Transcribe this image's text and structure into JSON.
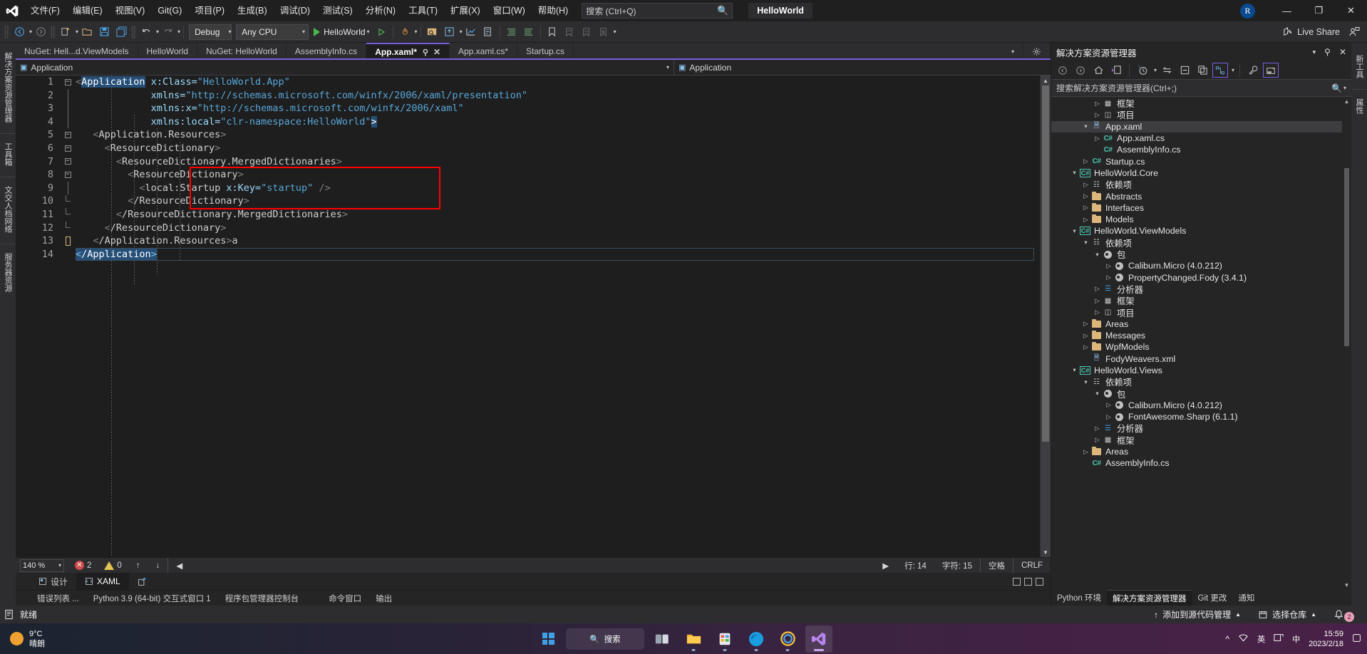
{
  "titlebar": {
    "menu": [
      "文件(F)",
      "编辑(E)",
      "视图(V)",
      "Git(G)",
      "项目(P)",
      "生成(B)",
      "调试(D)",
      "测试(S)",
      "分析(N)",
      "工具(T)",
      "扩展(X)",
      "窗口(W)",
      "帮助(H)"
    ],
    "search_placeholder": "搜索 (Ctrl+Q)",
    "project_title": "HelloWorld",
    "account_initial": "R",
    "minimize": "—",
    "restore": "❐",
    "close": "✕"
  },
  "toolbar": {
    "config": "Debug",
    "platform": "Any CPU",
    "run_target": "HelloWorld",
    "live_share": "Live Share"
  },
  "tabs": [
    {
      "label": "NuGet: Hell...d.ViewModels",
      "active": false
    },
    {
      "label": "HelloWorld",
      "active": false
    },
    {
      "label": "NuGet: HelloWorld",
      "active": false
    },
    {
      "label": "AssemblyInfo.cs",
      "active": false
    },
    {
      "label": "App.xaml*",
      "active": true
    },
    {
      "label": "App.xaml.cs*",
      "active": false
    },
    {
      "label": "Startup.cs",
      "active": false
    }
  ],
  "navbar": {
    "left_scope": "Application",
    "right_scope": "Application"
  },
  "left_dock": [
    "解决方案资源管理器",
    "工具箱",
    "文交人档网络",
    "服务器资源"
  ],
  "right_dock": [
    "新工具",
    "属性"
  ],
  "editor": {
    "lines": [
      {
        "n": 1,
        "fold": "minus"
      },
      {
        "n": 2,
        "fold": ""
      },
      {
        "n": 3,
        "fold": ""
      },
      {
        "n": 4,
        "fold": ""
      },
      {
        "n": 5,
        "fold": "minus"
      },
      {
        "n": 6,
        "fold": "minus"
      },
      {
        "n": 7,
        "fold": "minus"
      },
      {
        "n": 8,
        "fold": "minus"
      },
      {
        "n": 9,
        "fold": ""
      },
      {
        "n": 10,
        "fold": "end"
      },
      {
        "n": 11,
        "fold": "end"
      },
      {
        "n": 12,
        "fold": "end"
      },
      {
        "n": 13,
        "fold": "end"
      },
      {
        "n": 14,
        "fold": ""
      }
    ],
    "code": {
      "l1_tag": "Application",
      "l1_attr": "x:Class=",
      "l1_val": "\"HelloWorld.App\"",
      "l2_attr": "xmlns=",
      "l2_val": "\"http://schemas.microsoft.com/winfx/2006/xaml/presentation\"",
      "l3_attr": "xmlns:x=",
      "l3_val": "\"http://schemas.microsoft.com/winfx/2006/xaml\"",
      "l4_attr": "xmlns:local=",
      "l4_val": "\"clr-namespace:HelloWorld\"",
      "l5": "Application.Resources",
      "l6": "ResourceDictionary",
      "l7": "ResourceDictionary.MergedDictionaries",
      "l8": "ResourceDictionary",
      "l9_tag": "local:Startup",
      "l9_attr": "x:Key=",
      "l9_val": "\"startup\"",
      "l10": "/ResourceDictionary",
      "l11": "/ResourceDictionary.MergedDictionaries",
      "l12": "/ResourceDictionary",
      "l13": "/Application.Resources",
      "l14": "/Application"
    },
    "status": {
      "zoom": "140 %",
      "errors": "2",
      "warnings": "0",
      "line_label": "行: 14",
      "col_label": "字符: 15",
      "spaces": "空格",
      "eol": "CRLF"
    },
    "designer_tabs": [
      {
        "label": "设计",
        "active": false
      },
      {
        "label": "XAML",
        "active": true
      }
    ]
  },
  "solution_explorer": {
    "title": "解决方案资源管理器",
    "search_placeholder": "搜索解决方案资源管理器(Ctrl+;)",
    "tree": [
      {
        "indent": 3,
        "arrow": "collapsed",
        "icon": "framework",
        "label": "框架"
      },
      {
        "indent": 3,
        "arrow": "collapsed",
        "icon": "project",
        "label": "项目"
      },
      {
        "indent": 2,
        "arrow": "expanded",
        "icon": "xaml",
        "label": "App.xaml",
        "selected": true
      },
      {
        "indent": 3,
        "arrow": "collapsed",
        "icon": "cs",
        "label": "App.xaml.cs"
      },
      {
        "indent": 3,
        "arrow": "none",
        "icon": "cs",
        "label": "AssemblyInfo.cs"
      },
      {
        "indent": 2,
        "arrow": "collapsed",
        "icon": "cs",
        "label": "Startup.cs"
      },
      {
        "indent": 1,
        "arrow": "expanded",
        "icon": "csproj",
        "label": "HelloWorld.Core"
      },
      {
        "indent": 2,
        "arrow": "collapsed",
        "icon": "deps",
        "label": "依赖项"
      },
      {
        "indent": 2,
        "arrow": "collapsed",
        "icon": "folder",
        "label": "Abstracts"
      },
      {
        "indent": 2,
        "arrow": "collapsed",
        "icon": "folder",
        "label": "Interfaces"
      },
      {
        "indent": 2,
        "arrow": "collapsed",
        "icon": "folder",
        "label": "Models"
      },
      {
        "indent": 1,
        "arrow": "expanded",
        "icon": "csproj",
        "label": "HelloWorld.ViewModels"
      },
      {
        "indent": 2,
        "arrow": "expanded",
        "icon": "deps",
        "label": "依赖项"
      },
      {
        "indent": 3,
        "arrow": "expanded",
        "icon": "package",
        "label": "包"
      },
      {
        "indent": 4,
        "arrow": "collapsed",
        "icon": "package",
        "label": "Caliburn.Micro (4.0.212)"
      },
      {
        "indent": 4,
        "arrow": "collapsed",
        "icon": "package",
        "label": "PropertyChanged.Fody (3.4.1)"
      },
      {
        "indent": 3,
        "arrow": "collapsed",
        "icon": "analyzer",
        "label": "分析器"
      },
      {
        "indent": 3,
        "arrow": "collapsed",
        "icon": "framework",
        "label": "框架"
      },
      {
        "indent": 3,
        "arrow": "collapsed",
        "icon": "project",
        "label": "项目"
      },
      {
        "indent": 2,
        "arrow": "collapsed",
        "icon": "folder",
        "label": "Areas"
      },
      {
        "indent": 2,
        "arrow": "collapsed",
        "icon": "folder",
        "label": "Messages"
      },
      {
        "indent": 2,
        "arrow": "collapsed",
        "icon": "folder",
        "label": "WpfModels"
      },
      {
        "indent": 2,
        "arrow": "none",
        "icon": "xml",
        "label": "FodyWeavers.xml"
      },
      {
        "indent": 1,
        "arrow": "expanded",
        "icon": "csproj",
        "label": "HelloWorld.Views"
      },
      {
        "indent": 2,
        "arrow": "expanded",
        "icon": "deps",
        "label": "依赖项"
      },
      {
        "indent": 3,
        "arrow": "expanded",
        "icon": "package",
        "label": "包"
      },
      {
        "indent": 4,
        "arrow": "collapsed",
        "icon": "package",
        "label": "Caliburn.Micro (4.0.212)"
      },
      {
        "indent": 4,
        "arrow": "collapsed",
        "icon": "package",
        "label": "FontAwesome.Sharp (6.1.1)"
      },
      {
        "indent": 3,
        "arrow": "collapsed",
        "icon": "analyzer",
        "label": "分析器"
      },
      {
        "indent": 3,
        "arrow": "collapsed",
        "icon": "framework",
        "label": "框架"
      },
      {
        "indent": 2,
        "arrow": "collapsed",
        "icon": "folder",
        "label": "Areas"
      },
      {
        "indent": 2,
        "arrow": "none",
        "icon": "cs",
        "label": "AssemblyInfo.cs"
      }
    ],
    "bottom_tabs": [
      {
        "label": "Python 环境",
        "active": false
      },
      {
        "label": "解决方案资源管理器",
        "active": true
      },
      {
        "label": "Git 更改",
        "active": false
      },
      {
        "label": "通知",
        "active": false
      }
    ]
  },
  "bottom_panel_tabs": [
    "错误列表 ...",
    "Python 3.9 (64-bit) 交互式窗口 1",
    "程序包管理器控制台",
    "命令窗口",
    "输出"
  ],
  "vs_status": {
    "ready": "就绪",
    "source_control": "添加到源代码管理",
    "repository": "选择仓库",
    "notification_count": "2"
  },
  "taskbar": {
    "weather_temp": "9°C",
    "weather_desc": "晴朗",
    "search_label": "搜索",
    "ime_lang": "英",
    "time": "15:59",
    "date": "2023/2/18"
  },
  "colors": {
    "accent_purple": "#7a5fe0",
    "highlight_red": "#ff0000",
    "selection_blue": "#264f78",
    "chrome_bg": "#2d2d30",
    "editor_bg": "#1e1e1e"
  }
}
